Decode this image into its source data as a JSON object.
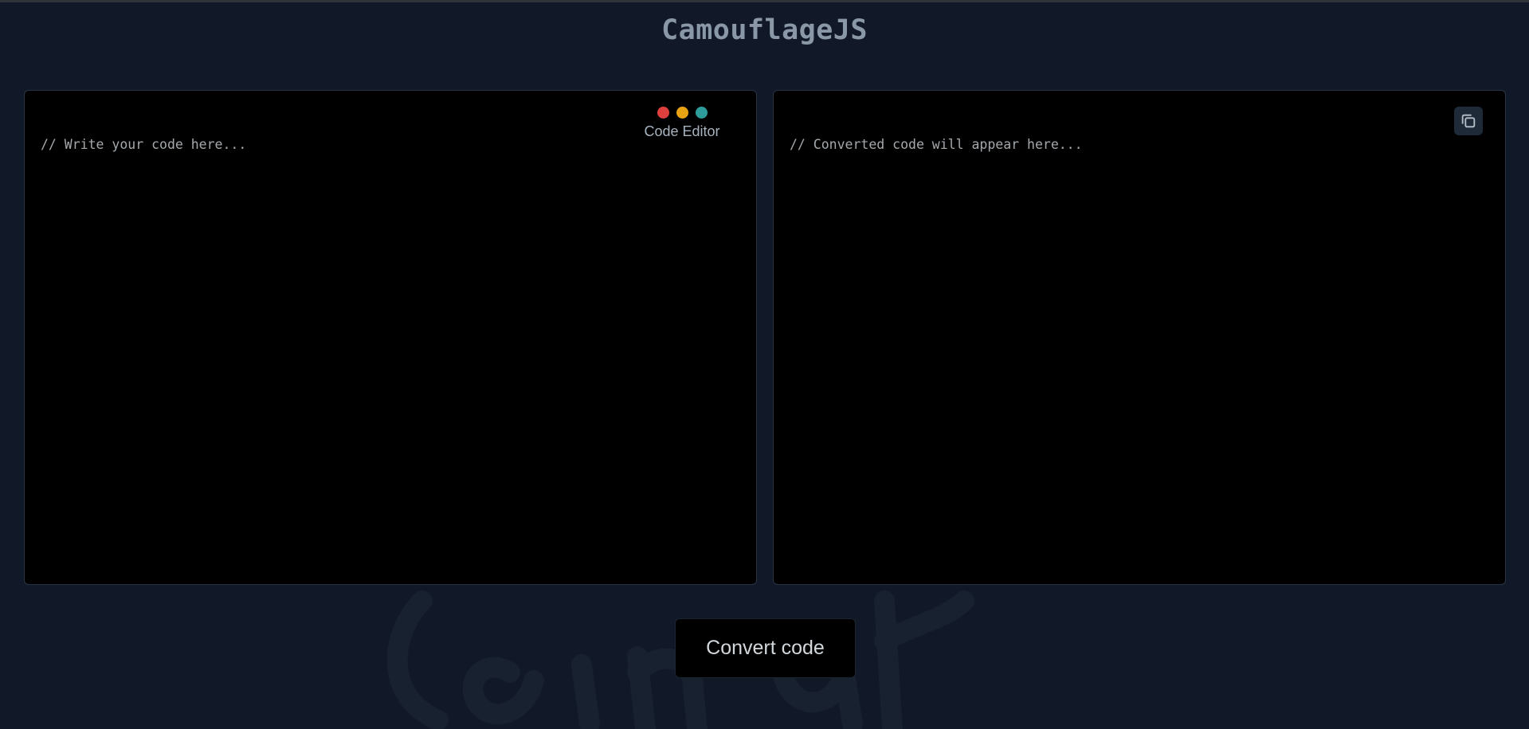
{
  "app": {
    "title": "CamouflageJS"
  },
  "editor": {
    "label": "Code Editor",
    "placeholder": "// Write your code here...",
    "value": "",
    "window_dots": [
      {
        "name": "red-dot",
        "color": "#e0403d"
      },
      {
        "name": "yellow-dot",
        "color": "#e8a312"
      },
      {
        "name": "teal-dot",
        "color": "#2d9c9a"
      }
    ]
  },
  "output": {
    "placeholder": "// Converted code will appear here...",
    "value": "",
    "copy_icon": "copy-icon"
  },
  "actions": {
    "convert_label": "Convert code"
  },
  "theme": {
    "background": "#111827",
    "panel_background": "#000000",
    "title_color": "#8a97a6"
  }
}
